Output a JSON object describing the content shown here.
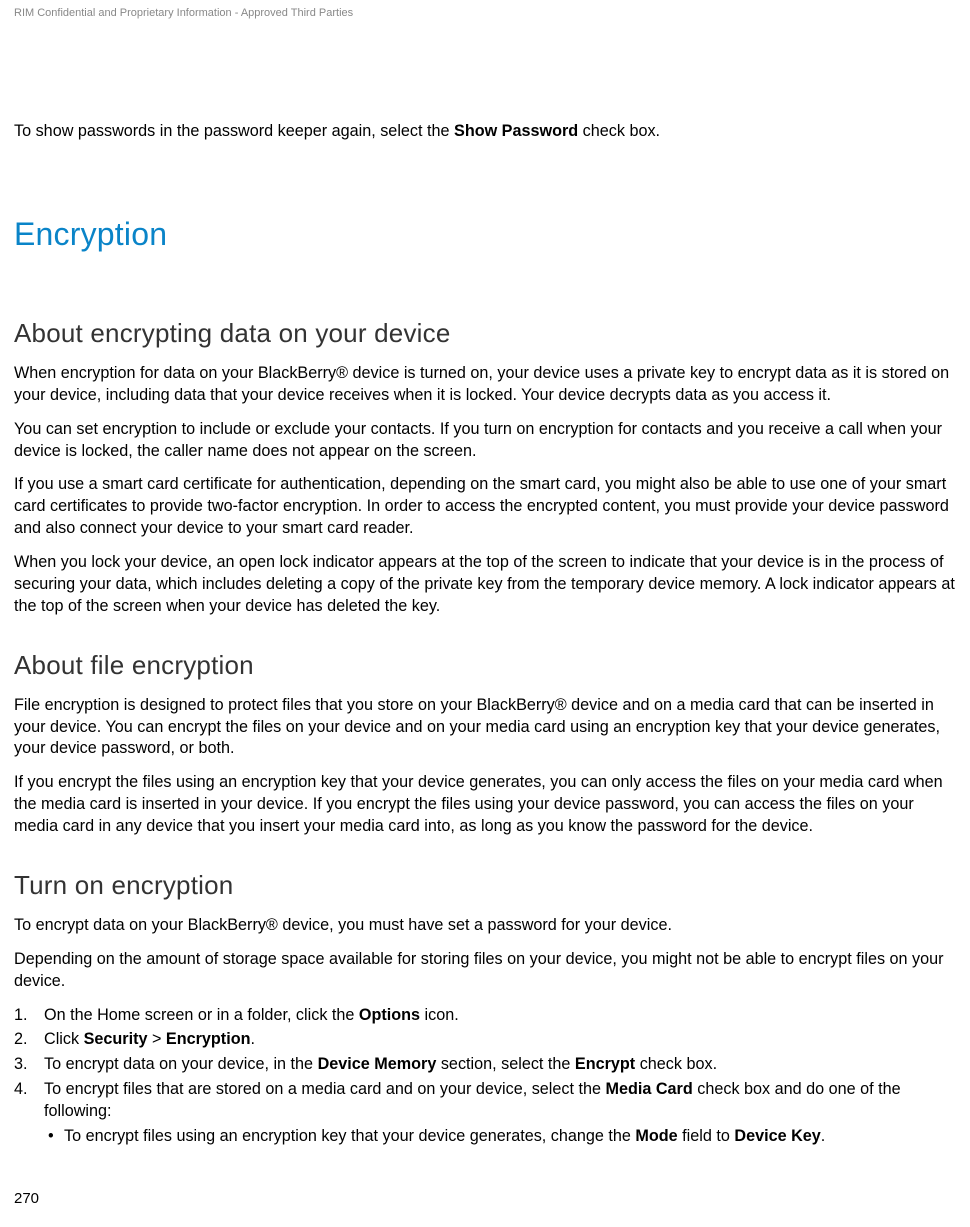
{
  "header": {
    "confidential": "RIM Confidential and Proprietary Information - Approved Third Parties"
  },
  "intro": {
    "prefix": "To show passwords in the password keeper again, select the ",
    "bold": "Show Password",
    "suffix": " check box."
  },
  "h1": "Encryption",
  "sections": {
    "about_data": {
      "title": "About encrypting data on your device",
      "p1": "When encryption for data on your BlackBerry® device is turned on, your device uses a private key to encrypt data as it is stored on your device, including data that your device receives when it is locked. Your device decrypts data as you access it.",
      "p2": "You can set encryption to include or exclude your contacts. If you turn on encryption for contacts and you receive a call when your device is locked, the caller name does not appear on the screen.",
      "p3": "If you use a smart card certificate for authentication, depending on the smart card, you might also be able to use one of your smart card certificates to provide two-factor encryption. In order to access the encrypted content, you must provide your device password and also connect your device to your smart card reader.",
      "p4": "When you lock your device, an open lock indicator appears at the top of the screen to indicate that your device is in the process of securing your data, which includes deleting a copy of the private key from the temporary device memory. A lock indicator appears at the top of the screen when your device has deleted the key."
    },
    "about_file": {
      "title": "About file encryption",
      "p1": "File encryption is designed to protect files that you store on your BlackBerry® device and on a media card that can be inserted in your device. You can encrypt the files on your device and on your media card using an encryption key that your device generates, your device password, or both.",
      "p2": "If you encrypt the files using an encryption key that your device generates, you can only access the files on your media card when the media card is inserted in your device. If you encrypt the files using your device password, you can access the files on your media card in any device that you insert your media card into, as long as you know the password for the device."
    },
    "turn_on": {
      "title": "Turn on encryption",
      "p1": "To encrypt data on your BlackBerry® device, you must have set a password for your device.",
      "p2": "Depending on the amount of storage space available for storing files on your device, you might not be able to encrypt files on your device.",
      "step1_a": "On the Home screen or in a folder, click the ",
      "step1_b": "Options",
      "step1_c": " icon.",
      "step2_a": "Click ",
      "step2_b": "Security",
      "step2_c": " > ",
      "step2_d": "Encryption",
      "step2_e": ".",
      "step3_a": "To encrypt data on your device, in the ",
      "step3_b": "Device Memory",
      "step3_c": " section, select the ",
      "step3_d": "Encrypt",
      "step3_e": " check box.",
      "step4_a": "To encrypt files that are stored on a media card and on your device, select the ",
      "step4_b": "Media Card",
      "step4_c": " check box and do one of the following:",
      "bullet1_a": "To encrypt files using an encryption key that your device generates, change the ",
      "bullet1_b": "Mode",
      "bullet1_c": " field to ",
      "bullet1_d": "Device Key",
      "bullet1_e": "."
    }
  },
  "page_number": "270"
}
